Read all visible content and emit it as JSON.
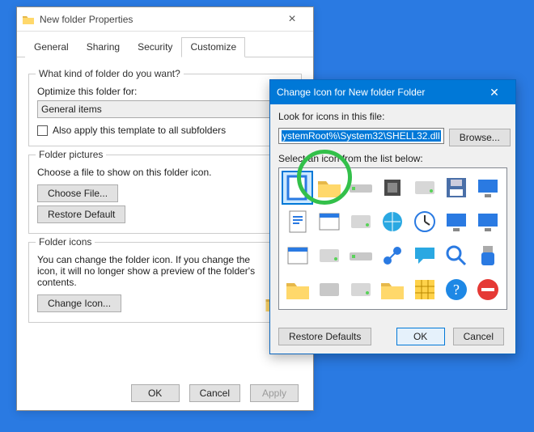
{
  "props": {
    "title": "New folder Properties",
    "tabs": [
      "General",
      "Sharing",
      "Security",
      "Customize"
    ],
    "active_tab": 3,
    "group_kind": {
      "label": "What kind of folder do you want?",
      "optimize_label": "Optimize this folder for:",
      "dropdown_value": "General items",
      "checkbox_label": "Also apply this template to all subfolders"
    },
    "group_pictures": {
      "label": "Folder pictures",
      "text": "Choose a file to show on this folder icon.",
      "choose_btn": "Choose File...",
      "restore_btn": "Restore Default"
    },
    "group_icons": {
      "label": "Folder icons",
      "text": "You can change the folder icon. If you change the icon, it will no longer show a preview of the folder's contents.",
      "change_btn": "Change Icon..."
    },
    "buttons": {
      "ok": "OK",
      "cancel": "Cancel",
      "apply": "Apply"
    }
  },
  "dlg": {
    "title": "Change Icon for New folder Folder",
    "look_label": "Look for icons in this file:",
    "path_value": "ystemRoot%\\System32\\SHELL32.dll",
    "browse_btn": "Browse...",
    "select_label": "Select an icon from the list below:",
    "restore_btn": "Restore Defaults",
    "ok_btn": "OK",
    "cancel_btn": "Cancel",
    "icons": [
      "blank-doc-icon",
      "folder-icon",
      "drive-icon",
      "chip-icon",
      "drive-gold-icon",
      "floppy-icon",
      "network-pc-icon",
      "text-doc-icon",
      "window-icon",
      "net-drive-icon",
      "globe-icon",
      "clock-icon",
      "monitor-blue-icon",
      "display-icon",
      "window-blank-icon",
      "hdd-icon",
      "drive-silver-icon",
      "network-globe-icon",
      "chat-icon",
      "search-icon",
      "usb-icon",
      "folder-small-icon",
      "scanner-icon",
      "drive-net-icon",
      "folder-open-icon",
      "grid-icon",
      "help-icon",
      "stop-icon"
    ],
    "selected_index": 0
  }
}
